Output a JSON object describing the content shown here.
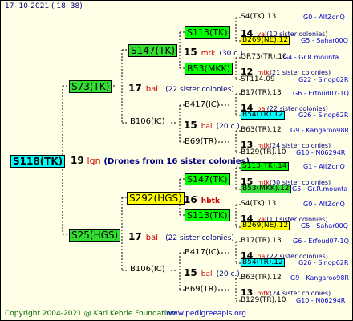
{
  "header_date": "17- 10-2021 ( 18: 38)",
  "footer": {
    "copyright": "Copyright 2004-2021 @ Karl Kehrle Foundation",
    "site": "www.pedigreeapis.org"
  },
  "root": {
    "id": "S118(TK)",
    "num": "19",
    "breed": "lgn",
    "note": "(Drones from 16 sister colonies)"
  },
  "upper": {
    "id": "S73(TK)",
    "num": "17",
    "breed": "bal",
    "note": "(22 sister colonies)",
    "f1": {
      "id": "S147(TK)",
      "num": "15",
      "breed": "mtk",
      "note": "(30 c.)",
      "a": {
        "id": "S113(TK)",
        "ra": "S4(TK).13",
        "rb": "G0 - AltZonQ",
        "num": "14",
        "breed": "val",
        "note": "(10 sister colonies)",
        "rc": "B269(NE).12",
        "rd": "G5 - Sahar00Q"
      },
      "b": {
        "id": "B53(MKK)",
        "ra": "GR73(TR).10",
        "rb": "G4 - Gr.R.mounta",
        "num": "12",
        "breed": "mtk",
        "note": "(21 sister colonies)",
        "rc": "ST114.09",
        "rd": "G22 - Sinop62R"
      }
    },
    "f2": {
      "id": "B106(IC)",
      "num": "15",
      "breed": "bal",
      "note": "(20 c.)",
      "a": {
        "id": "B417(IC)",
        "ra": "B17(TR).13",
        "rb": "G6 - Erfoud07-1Q",
        "num": "14",
        "breed": "bal",
        "note": "(22 sister colonies)",
        "rc": "B54(TR).12",
        "rd": "G26 - Sinop62R"
      },
      "b": {
        "id": "B69(TR)",
        "ra": "B63(TR).12",
        "rb": "G9 - Kangaroo98R",
        "num": "13",
        "breed": "mtk",
        "note": "(24 sister colonies)",
        "rc": "B129(TR).10",
        "rd": "G10 - N06294R"
      }
    }
  },
  "lower": {
    "id": "S25(HGS)",
    "num": "17",
    "breed": "bal",
    "note": "(22 sister colonies)",
    "f1": {
      "id": "S292(HGS)",
      "num": "16",
      "breed": "hbtk",
      "a": {
        "id": "S147(TK)",
        "ra": "S113(TK).14",
        "rb": "G1 - AltZonQ",
        "num": "15",
        "breed": "mtk",
        "note": "(30 sister colonies)",
        "rc": "B53(MKK).12",
        "rd": "G5 - Gr.R.mounta"
      },
      "b": {
        "id": "S113(TK)",
        "ra": "S4(TK).13",
        "rb": "G0 - AltZonQ",
        "num": "14",
        "breed": "val",
        "note": "(10 sister colonies)",
        "rc": "B269(NE).12",
        "rd": "G5 - Sahar00Q"
      }
    },
    "f2": {
      "id": "B106(IC)",
      "num": "15",
      "breed": "bal",
      "note": "(20 c.)",
      "a": {
        "id": "B417(IC)",
        "ra": "B17(TR).13",
        "rb": "G6 - Erfoud07-1Q",
        "num": "14",
        "breed": "bal",
        "note": "(22 sister colonies)",
        "rc": "B54(TR).12",
        "rd": "G26 - Sinop62R"
      },
      "b": {
        "id": "B69(TR)",
        "ra": "B63(TR).12",
        "rb": "G9 - Kangaroo98R",
        "num": "13",
        "breed": "mtk",
        "note": "(24 sister colonies)",
        "rc": "B129(TR).10",
        "rd": "G10 - N06294R"
      }
    }
  }
}
